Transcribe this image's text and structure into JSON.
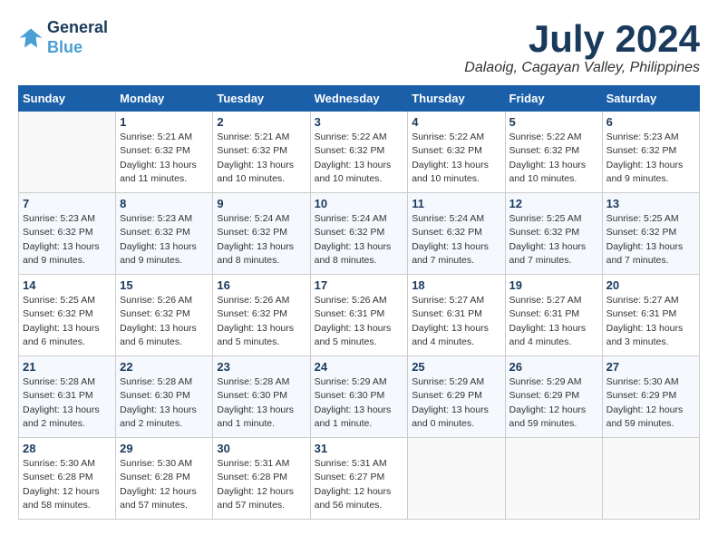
{
  "header": {
    "logo_line1": "General",
    "logo_line2": "Blue",
    "month_title": "July 2024",
    "location": "Dalaoig, Cagayan Valley, Philippines"
  },
  "weekdays": [
    "Sunday",
    "Monday",
    "Tuesday",
    "Wednesday",
    "Thursday",
    "Friday",
    "Saturday"
  ],
  "weeks": [
    [
      {
        "num": "",
        "info": ""
      },
      {
        "num": "1",
        "info": "Sunrise: 5:21 AM\nSunset: 6:32 PM\nDaylight: 13 hours\nand 11 minutes."
      },
      {
        "num": "2",
        "info": "Sunrise: 5:21 AM\nSunset: 6:32 PM\nDaylight: 13 hours\nand 10 minutes."
      },
      {
        "num": "3",
        "info": "Sunrise: 5:22 AM\nSunset: 6:32 PM\nDaylight: 13 hours\nand 10 minutes."
      },
      {
        "num": "4",
        "info": "Sunrise: 5:22 AM\nSunset: 6:32 PM\nDaylight: 13 hours\nand 10 minutes."
      },
      {
        "num": "5",
        "info": "Sunrise: 5:22 AM\nSunset: 6:32 PM\nDaylight: 13 hours\nand 10 minutes."
      },
      {
        "num": "6",
        "info": "Sunrise: 5:23 AM\nSunset: 6:32 PM\nDaylight: 13 hours\nand 9 minutes."
      }
    ],
    [
      {
        "num": "7",
        "info": "Sunrise: 5:23 AM\nSunset: 6:32 PM\nDaylight: 13 hours\nand 9 minutes."
      },
      {
        "num": "8",
        "info": "Sunrise: 5:23 AM\nSunset: 6:32 PM\nDaylight: 13 hours\nand 9 minutes."
      },
      {
        "num": "9",
        "info": "Sunrise: 5:24 AM\nSunset: 6:32 PM\nDaylight: 13 hours\nand 8 minutes."
      },
      {
        "num": "10",
        "info": "Sunrise: 5:24 AM\nSunset: 6:32 PM\nDaylight: 13 hours\nand 8 minutes."
      },
      {
        "num": "11",
        "info": "Sunrise: 5:24 AM\nSunset: 6:32 PM\nDaylight: 13 hours\nand 7 minutes."
      },
      {
        "num": "12",
        "info": "Sunrise: 5:25 AM\nSunset: 6:32 PM\nDaylight: 13 hours\nand 7 minutes."
      },
      {
        "num": "13",
        "info": "Sunrise: 5:25 AM\nSunset: 6:32 PM\nDaylight: 13 hours\nand 7 minutes."
      }
    ],
    [
      {
        "num": "14",
        "info": "Sunrise: 5:25 AM\nSunset: 6:32 PM\nDaylight: 13 hours\nand 6 minutes."
      },
      {
        "num": "15",
        "info": "Sunrise: 5:26 AM\nSunset: 6:32 PM\nDaylight: 13 hours\nand 6 minutes."
      },
      {
        "num": "16",
        "info": "Sunrise: 5:26 AM\nSunset: 6:32 PM\nDaylight: 13 hours\nand 5 minutes."
      },
      {
        "num": "17",
        "info": "Sunrise: 5:26 AM\nSunset: 6:31 PM\nDaylight: 13 hours\nand 5 minutes."
      },
      {
        "num": "18",
        "info": "Sunrise: 5:27 AM\nSunset: 6:31 PM\nDaylight: 13 hours\nand 4 minutes."
      },
      {
        "num": "19",
        "info": "Sunrise: 5:27 AM\nSunset: 6:31 PM\nDaylight: 13 hours\nand 4 minutes."
      },
      {
        "num": "20",
        "info": "Sunrise: 5:27 AM\nSunset: 6:31 PM\nDaylight: 13 hours\nand 3 minutes."
      }
    ],
    [
      {
        "num": "21",
        "info": "Sunrise: 5:28 AM\nSunset: 6:31 PM\nDaylight: 13 hours\nand 2 minutes."
      },
      {
        "num": "22",
        "info": "Sunrise: 5:28 AM\nSunset: 6:30 PM\nDaylight: 13 hours\nand 2 minutes."
      },
      {
        "num": "23",
        "info": "Sunrise: 5:28 AM\nSunset: 6:30 PM\nDaylight: 13 hours\nand 1 minute."
      },
      {
        "num": "24",
        "info": "Sunrise: 5:29 AM\nSunset: 6:30 PM\nDaylight: 13 hours\nand 1 minute."
      },
      {
        "num": "25",
        "info": "Sunrise: 5:29 AM\nSunset: 6:29 PM\nDaylight: 13 hours\nand 0 minutes."
      },
      {
        "num": "26",
        "info": "Sunrise: 5:29 AM\nSunset: 6:29 PM\nDaylight: 12 hours\nand 59 minutes."
      },
      {
        "num": "27",
        "info": "Sunrise: 5:30 AM\nSunset: 6:29 PM\nDaylight: 12 hours\nand 59 minutes."
      }
    ],
    [
      {
        "num": "28",
        "info": "Sunrise: 5:30 AM\nSunset: 6:28 PM\nDaylight: 12 hours\nand 58 minutes."
      },
      {
        "num": "29",
        "info": "Sunrise: 5:30 AM\nSunset: 6:28 PM\nDaylight: 12 hours\nand 57 minutes."
      },
      {
        "num": "30",
        "info": "Sunrise: 5:31 AM\nSunset: 6:28 PM\nDaylight: 12 hours\nand 57 minutes."
      },
      {
        "num": "31",
        "info": "Sunrise: 5:31 AM\nSunset: 6:27 PM\nDaylight: 12 hours\nand 56 minutes."
      },
      {
        "num": "",
        "info": ""
      },
      {
        "num": "",
        "info": ""
      },
      {
        "num": "",
        "info": ""
      }
    ]
  ]
}
